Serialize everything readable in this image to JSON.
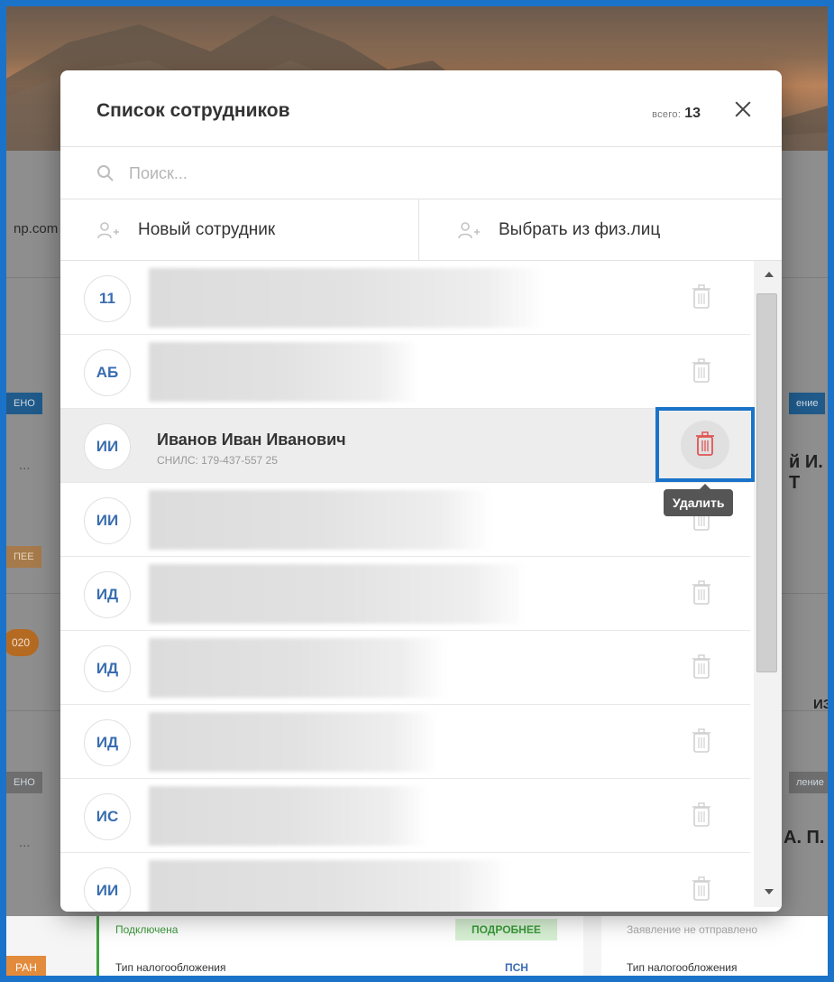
{
  "background": {
    "email_fragment": "np.com",
    "tags": [
      "ЕНО",
      "ЕНО",
      "ПЕЕ"
    ],
    "pill": "020",
    "dots": "...",
    "name_fragment_1": "й И. Т",
    "name_fragment_2": "А. П.",
    "edit_fragment": "ИЗ",
    "status_right": "ение",
    "status_right_2": "ление",
    "bottom": {
      "connected": "Подключена",
      "more_button": "ПОДРОБНЕЕ",
      "tax_label": "Тип налогообложения",
      "tax_value": "ПСН",
      "not_sent": "Заявление не отправлено",
      "tax_label_right": "Тип налогообложения",
      "orange_tag": "РАН"
    }
  },
  "modal": {
    "title": "Список сотрудников",
    "total_label": "всего:",
    "total_count": "13",
    "search": {
      "placeholder": "Поиск..."
    },
    "actions": {
      "new_employee": "Новый сотрудник",
      "choose_from_persons": "Выбрать из физ.лиц"
    },
    "employees": [
      {
        "initials": "11"
      },
      {
        "initials": "АБ"
      },
      {
        "initials": "ИИ",
        "name": "Иванов Иван Иванович",
        "snils": "СНИЛС: 179-437-557 25"
      },
      {
        "initials": "ИИ"
      },
      {
        "initials": "ИД"
      },
      {
        "initials": "ИД"
      },
      {
        "initials": "ИД"
      },
      {
        "initials": "ИС"
      },
      {
        "initials": "ИИ"
      }
    ],
    "tooltip": "Удалить"
  },
  "colors": {
    "accent": "#1a73c9",
    "avatar_text": "#3a6eb0",
    "delete_red": "#e05555"
  }
}
